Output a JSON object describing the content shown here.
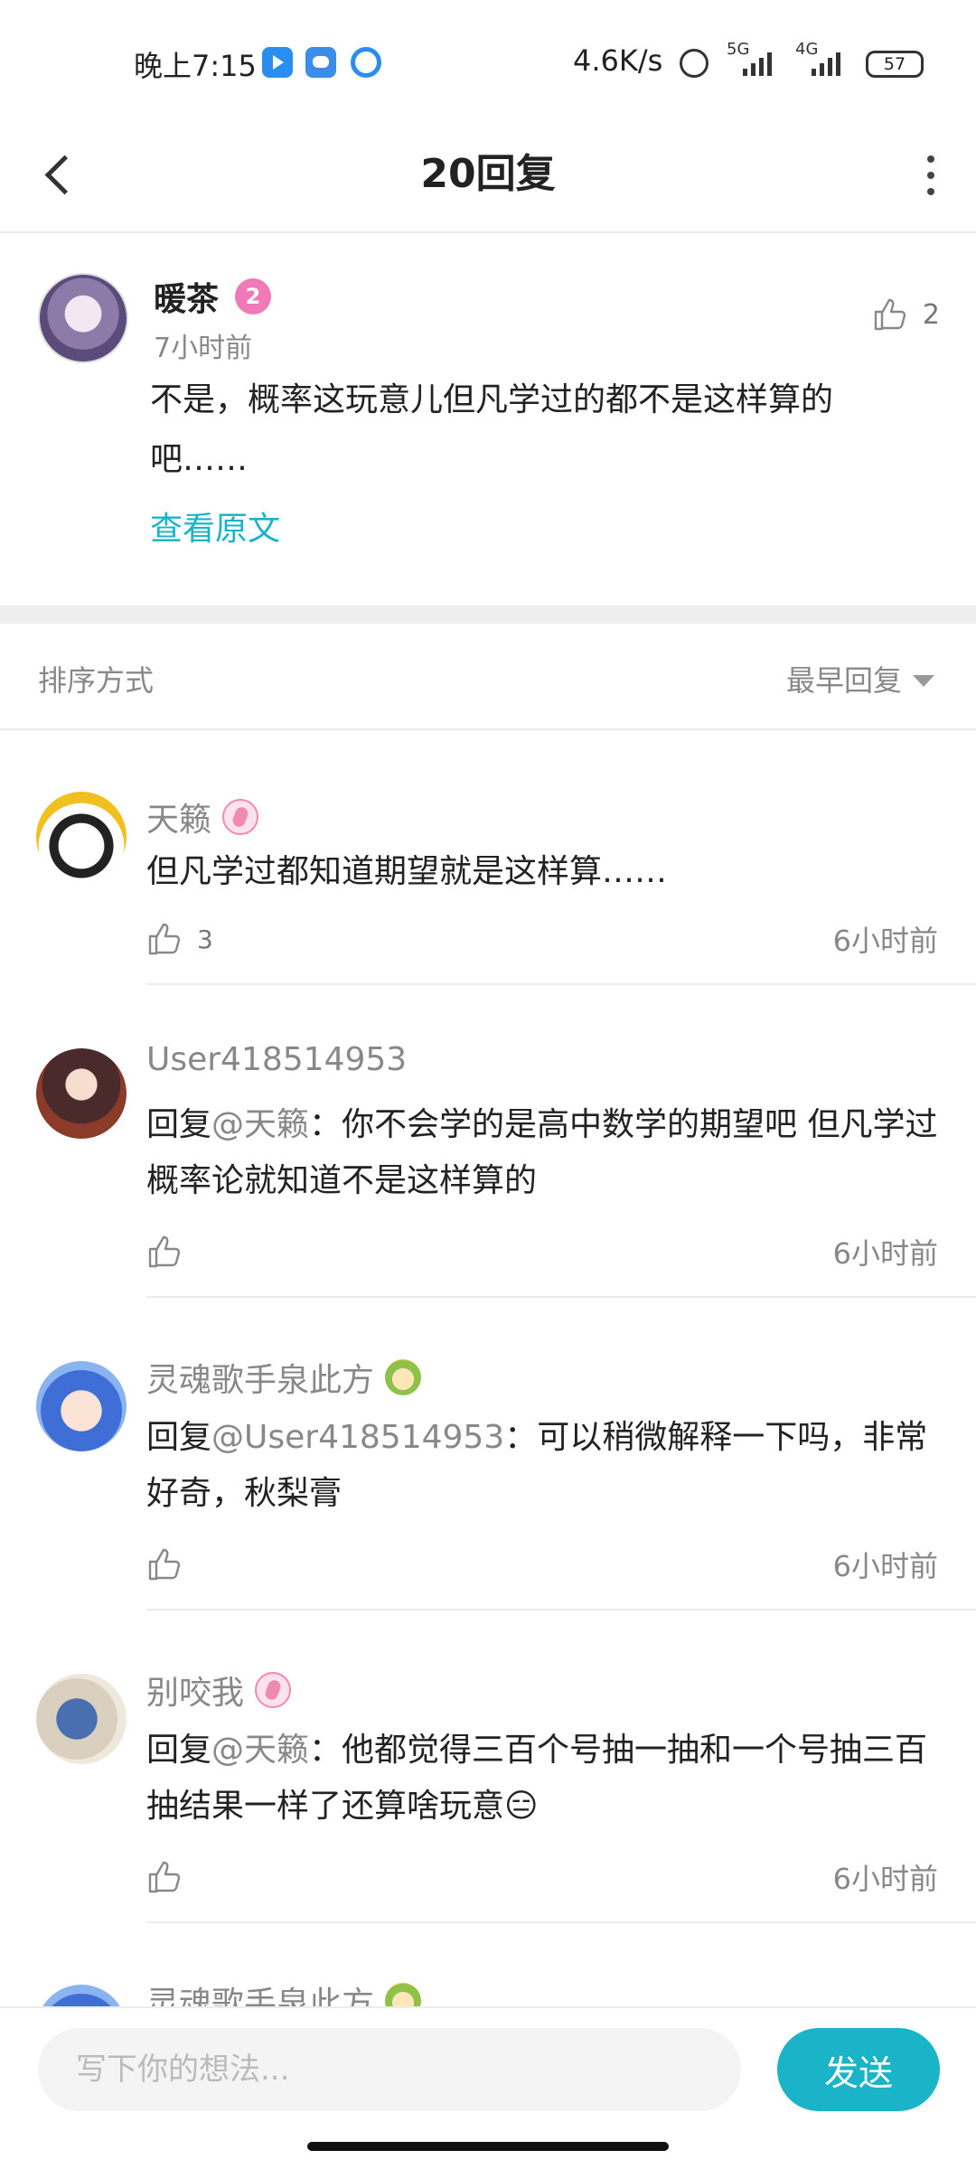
{
  "status_bar": {
    "time": "晚上7:15",
    "net_speed": "4.6K/s",
    "signal1": "5G",
    "signal2": "4G",
    "battery": "57"
  },
  "header": {
    "title": "20回复"
  },
  "post": {
    "author": "暖茶",
    "level": "2",
    "time": "7小时前",
    "likes": "2",
    "content": "不是，概率这玩意儿但凡学过的都不是这样算的吧……",
    "view_original": "查看原文"
  },
  "sort": {
    "label": "排序方式",
    "selected": "最早回复"
  },
  "replies": [
    {
      "author": "天籁",
      "prefix": "",
      "mention": "",
      "text": "但凡学过都知道期望就是这样算……",
      "likes": "3",
      "time": "6小时前"
    },
    {
      "author": "User418514953",
      "prefix": "回复",
      "mention": "@天籁",
      "text": "：你不会学的是高中数学的期望吧 但凡学过概率论就知道不是这样算的",
      "likes": "",
      "time": "6小时前"
    },
    {
      "author": "灵魂歌手泉此方",
      "prefix": "回复",
      "mention": "@User418514953",
      "text": "：可以稍微解释一下吗，非常好奇，秋梨膏",
      "likes": "",
      "time": "6小时前"
    },
    {
      "author": "别咬我",
      "prefix": "回复",
      "mention": "@天籁",
      "text": "：他都觉得三百个号抽一抽和一个号抽三百抽结果一样了还算啥玩意😑",
      "likes": "",
      "time": "6小时前"
    },
    {
      "author": "灵魂歌手泉此方"
    }
  ],
  "composer": {
    "placeholder": "写下你的想法...",
    "send_label": "发送"
  },
  "colors": {
    "accent": "#1bb3c8",
    "muted_text": "#888888"
  }
}
